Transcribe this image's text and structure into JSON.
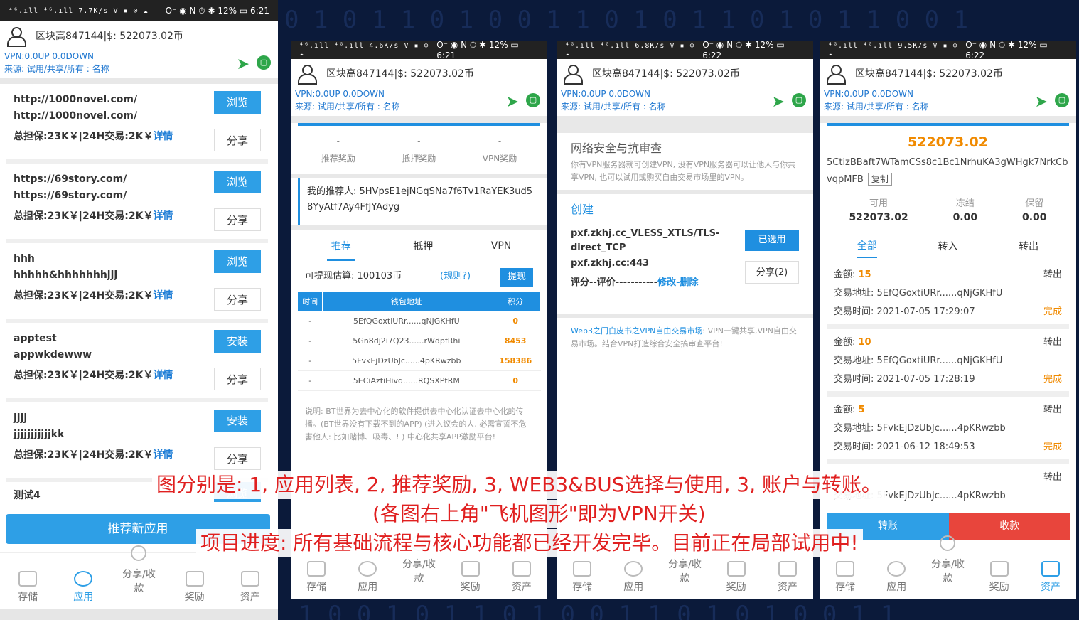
{
  "status": {
    "signal": "⁴ᴳ.ıll ⁴ᴳ.ıll",
    "icons": "O⁻ ◉ N ⏱ ✱",
    "battery": "12%",
    "time1": "6:21",
    "time2": "6:21",
    "time3": "6:22",
    "time4": "6:22",
    "speed1": "7.7",
    "speed2": "4.6",
    "speed3": "6.8",
    "speed4": "9.5",
    "speed_unit": "K/s"
  },
  "header": {
    "title": "区块高847144|$: 522073.02币",
    "vpn": "VPN:0.0UP  0.0DOWN",
    "source": "来源: 试用/共享/所有 : 名称"
  },
  "apps": [
    {
      "line1": "http://1000novel.com/",
      "line2": "http://1000novel.com/",
      "line3": "总担保:23K￥|24H交易:2K￥",
      "detail": "详情",
      "action": "浏览",
      "share": "分享"
    },
    {
      "line1": "https://69story.com/",
      "line2": "https://69story.com/",
      "line3": "总担保:23K￥|24H交易:2K￥",
      "detail": "详情",
      "action": "浏览",
      "share": "分享"
    },
    {
      "line1": "hhh",
      "line2": "hhhhh&hhhhhhhjjj",
      "line3": "总担保:23K￥|24H交易:2K￥",
      "detail": "详情",
      "action": "浏览",
      "share": "分享"
    },
    {
      "line1": "apptest",
      "line2": "appwkdewww",
      "line3": "总担保:23K￥|24H交易:2K￥",
      "detail": "详情",
      "action": "安装",
      "share": "分享"
    },
    {
      "line1": "jjjj",
      "line2": "jjjjjjjjjjjkk",
      "line3": "总担保:23K￥|24H交易:2K￥",
      "detail": "详情",
      "action": "安装",
      "share": "分享"
    }
  ],
  "partial_app": {
    "line1": "测试4",
    "action": "浏览"
  },
  "recommend_button": "推荐新应用",
  "nav": {
    "storage": "存储",
    "apps": "应用",
    "share": "分享/收款",
    "rewards": "奖励",
    "assets": "资产"
  },
  "rewards": {
    "v1": "-",
    "l1": "推荐奖励",
    "v2": "-",
    "l2": "抵押奖励",
    "v3": "-",
    "l3": "VPN奖励"
  },
  "referrer": "我的推荐人: 5HVpsE1ejNGqSNa7f6Tv1RaYEK3ud58YyAtf7Ay4FfJYAdyg",
  "tabs2": {
    "t1": "推荐",
    "t2": "抵押",
    "t3": "VPN"
  },
  "withdraw": {
    "label": "可提现估算: 100103币",
    "rule": "(规则?)",
    "button": "提现"
  },
  "ref_table": {
    "headers": [
      "时间",
      "钱包地址",
      "积分"
    ],
    "rows": [
      [
        "-",
        "5EfQGoxtiURr......qNjGKHfU",
        "0"
      ],
      [
        "-",
        "5Gn8dj2i7Q23......rWdpfRhi",
        "8453"
      ],
      [
        "-",
        "5FvkEjDzUbJc......4pKRwzbb",
        "158386"
      ],
      [
        "-",
        "5ECiAztiHivq......RQSXPtRM",
        "0"
      ]
    ]
  },
  "note": "说明: BT世界为去中心化的软件提供去中心化认证去中心化的传播。(BT世界没有下载不到的APP) (进入议会的人, 必需宣誓不危害他人: 比如赌博、吸毒、! ) 中心化共享APP激励平台!",
  "net": {
    "title": "网络安全与抗审查",
    "desc": "你有VPN服务器就可创建VPN, 没有VPN服务器可以让他人与你共享VPN, 也可以试用或购买自由交易市场里的VPN。",
    "create": "创建",
    "svc_name": "pxf.zkhj.cc_VLESS_XTLS/TLS-direct_TCP",
    "svc_host": "pxf.zkhj.cc:443",
    "rating": "评分--评价-----------",
    "edit": "修改-删除",
    "selected": "已选用",
    "share": "分享(2)",
    "web3_link": "Web3之门白皮书之VPN自由交易市场",
    "web3_text": ": VPN一键共享,VPN自由交易市场。结合VPN打造综合安全搞审查平台!"
  },
  "account": {
    "balance": "522073.02",
    "address": "5CtizBBaft7WTamCSs8c1Bc1NrhuKA3gWHgk7NrkCbvqpMFB",
    "copy": "复制",
    "labels": [
      "可用",
      "冻结",
      "保留"
    ],
    "values": [
      "522073.02",
      "0.00",
      "0.00"
    ],
    "tabs": [
      "全部",
      "转入",
      "转出"
    ]
  },
  "tx_labels": {
    "amount": "金额: ",
    "addr": "交易地址: ",
    "time": "交易时间: "
  },
  "transactions": [
    {
      "amount": "15",
      "dir": "转出",
      "addr": "5EfQGoxtiURr......qNjGKHfU",
      "time": "2021-07-05 17:29:07",
      "status": "完成"
    },
    {
      "amount": "10",
      "dir": "转出",
      "addr": "5EfQGoxtiURr......qNjGKHfU",
      "time": "2021-07-05 17:28:19",
      "status": "完成"
    },
    {
      "amount": "5",
      "dir": "转出",
      "addr": "5FvkEjDzUbJc......4pKRwzbb",
      "time": "2021-06-12 18:49:53",
      "status": "完成"
    },
    {
      "amount": "",
      "dir": "转出",
      "addr": "5FvkEjDzUbJc......4pKRwzbb",
      "time": "",
      "status": ""
    }
  ],
  "account_actions": {
    "transfer": "转账",
    "receive": "收款"
  },
  "captions": {
    "c1": "图分别是: 1, 应用列表, 2, 推荐奖励, 3, WEB3&BUS选择与使用, 3, 账户与转账。",
    "c2": "(各图右上角\"飞机图形\"即为VPN开关)",
    "c3": "项目进度: 所有基础流程与核心功能都已经开发完毕。目前正在局部试用中!"
  },
  "colors": {
    "accent": "#2e9fe6",
    "orange": "#f08a00",
    "red": "#e8453c",
    "caption": "#e02020",
    "vpn_green": "#2ea64a"
  }
}
